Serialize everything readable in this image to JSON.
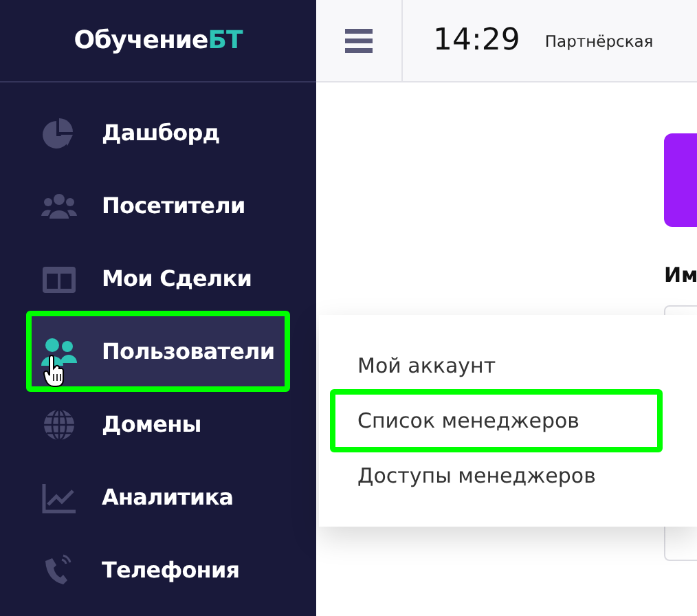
{
  "logo": {
    "text": "Обучение",
    "accent": "БТ"
  },
  "sidebar": {
    "items": [
      {
        "label": "Дашборд",
        "kind": "pie",
        "selected": false,
        "annotated": false
      },
      {
        "label": "Посетители",
        "kind": "group",
        "selected": false,
        "annotated": false
      },
      {
        "label": "Мои Сделки",
        "kind": "columns",
        "selected": false,
        "annotated": false
      },
      {
        "label": "Пользователи",
        "kind": "users",
        "selected": true,
        "annotated": true
      },
      {
        "label": "Домены",
        "kind": "globe",
        "selected": false,
        "annotated": false
      },
      {
        "label": "Аналитика",
        "kind": "chart",
        "selected": false,
        "annotated": false
      },
      {
        "label": "Телефония",
        "kind": "phone",
        "selected": false,
        "annotated": false
      }
    ]
  },
  "header": {
    "time": "14:29",
    "title": "Партнёрская"
  },
  "content": {
    "label": "Им"
  },
  "dropdown": {
    "items": [
      {
        "label": "Мой аккаунт",
        "annotated": false
      },
      {
        "label": "Список менеджеров",
        "annotated": true
      },
      {
        "label": "Доступы менеджеров",
        "annotated": false
      }
    ]
  }
}
